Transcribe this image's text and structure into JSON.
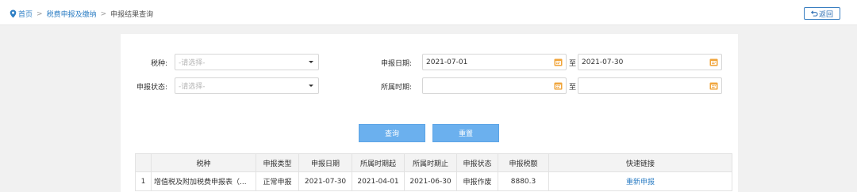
{
  "breadcrumb": {
    "home": "首页",
    "sep": ">",
    "section": "税费申报及缴纳",
    "current": "申报结果查询"
  },
  "back_label": "返回",
  "form": {
    "tax_type": {
      "label": "税种:",
      "placeholder": "-请选择-"
    },
    "declare_date": {
      "label": "申报日期:",
      "from": "2021-07-01",
      "to": "2021-07-30"
    },
    "declare_status": {
      "label": "申报状态:",
      "placeholder": "-请选择-"
    },
    "period": {
      "label": "所属时期:",
      "from": "",
      "to": ""
    },
    "to_label": "至"
  },
  "buttons": {
    "query": "查询",
    "reset": "重置"
  },
  "table": {
    "headers": [
      "",
      "税种",
      "申报类型",
      "申报日期",
      "所属时期起",
      "所属时期止",
      "申报状态",
      "申报税额",
      "快速链接"
    ],
    "rows": [
      {
        "index": "1",
        "tax_type": "增值税及附加税费申报表（...",
        "type": "正常申报",
        "date": "2021-07-30",
        "period_from": "2021-04-01",
        "period_to": "2021-06-30",
        "status": "申报作废",
        "amount": "8880.3",
        "link": "重新申报"
      }
    ]
  },
  "colors": {
    "accent": "#2d7ec4",
    "button": "#6bb0ee",
    "calendar_icon": "#f0a43a"
  }
}
